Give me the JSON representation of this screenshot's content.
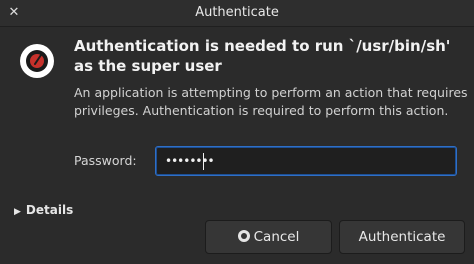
{
  "window": {
    "title": "Authenticate",
    "close_glyph": "✕"
  },
  "dialog": {
    "heading": "Authentication is needed to run `/usr/bin/sh' as the super user",
    "description": "An application is attempting to perform an action that requires privileges. Authentication is required to perform this action.",
    "password_label": "Password:",
    "password_value": "••••••••",
    "details_label": "Details",
    "details_arrow": "▶",
    "cancel_label": "Cancel",
    "authenticate_label": "Authenticate",
    "icons": {
      "app": "app-badge-icon",
      "cancel": "cancel-icon",
      "close": "close-icon"
    }
  },
  "colors": {
    "background": "#2b2b2b",
    "focus_border": "#2f6fc6",
    "app_icon_accent": "#c6312b"
  }
}
